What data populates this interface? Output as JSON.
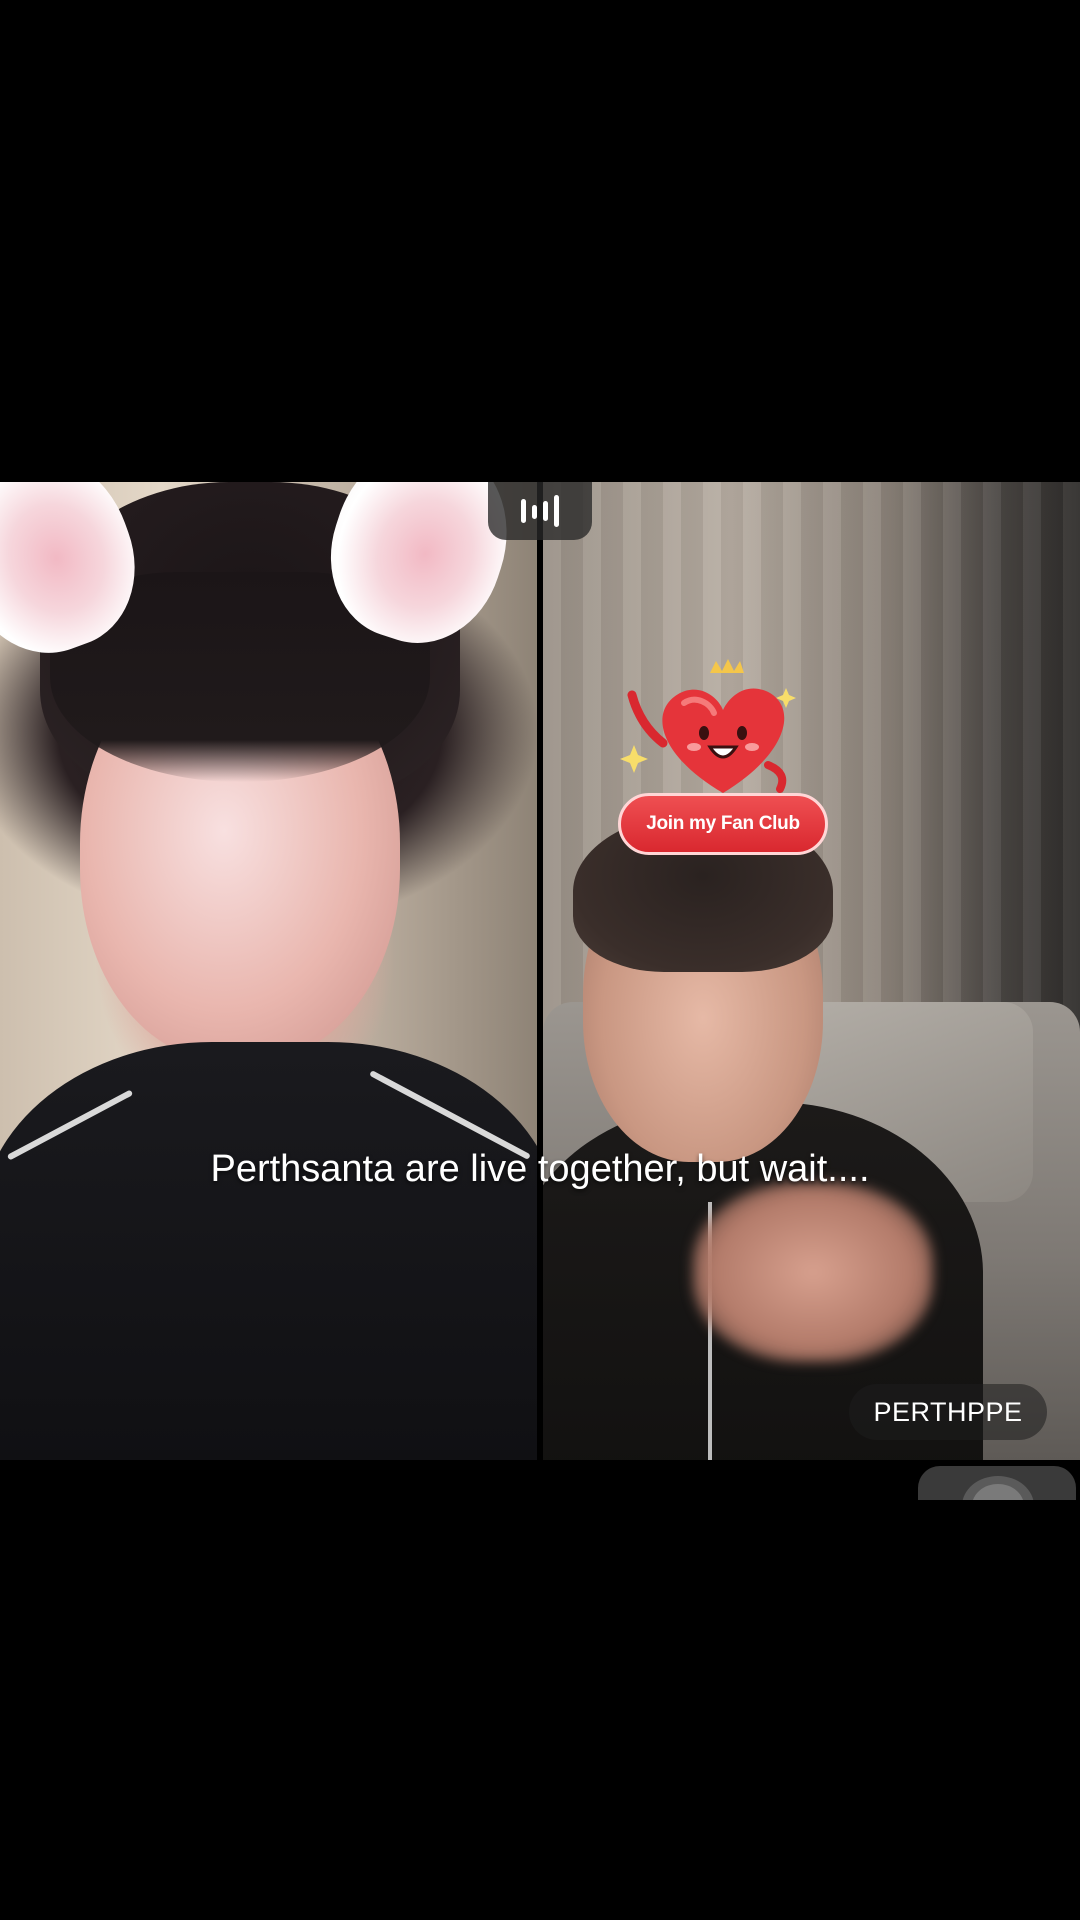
{
  "caption": {
    "text": "Perthsanta are live together, but wait...."
  },
  "audio_tab": {
    "icon": "audio-level-icon"
  },
  "fan_club": {
    "label": "Join my Fan Club",
    "icon": "heart-mascot-icon",
    "accent": "#e5343a"
  },
  "participant_right": {
    "username": "PERTHPPE"
  },
  "corner_control": {
    "icon": "more-icon"
  }
}
